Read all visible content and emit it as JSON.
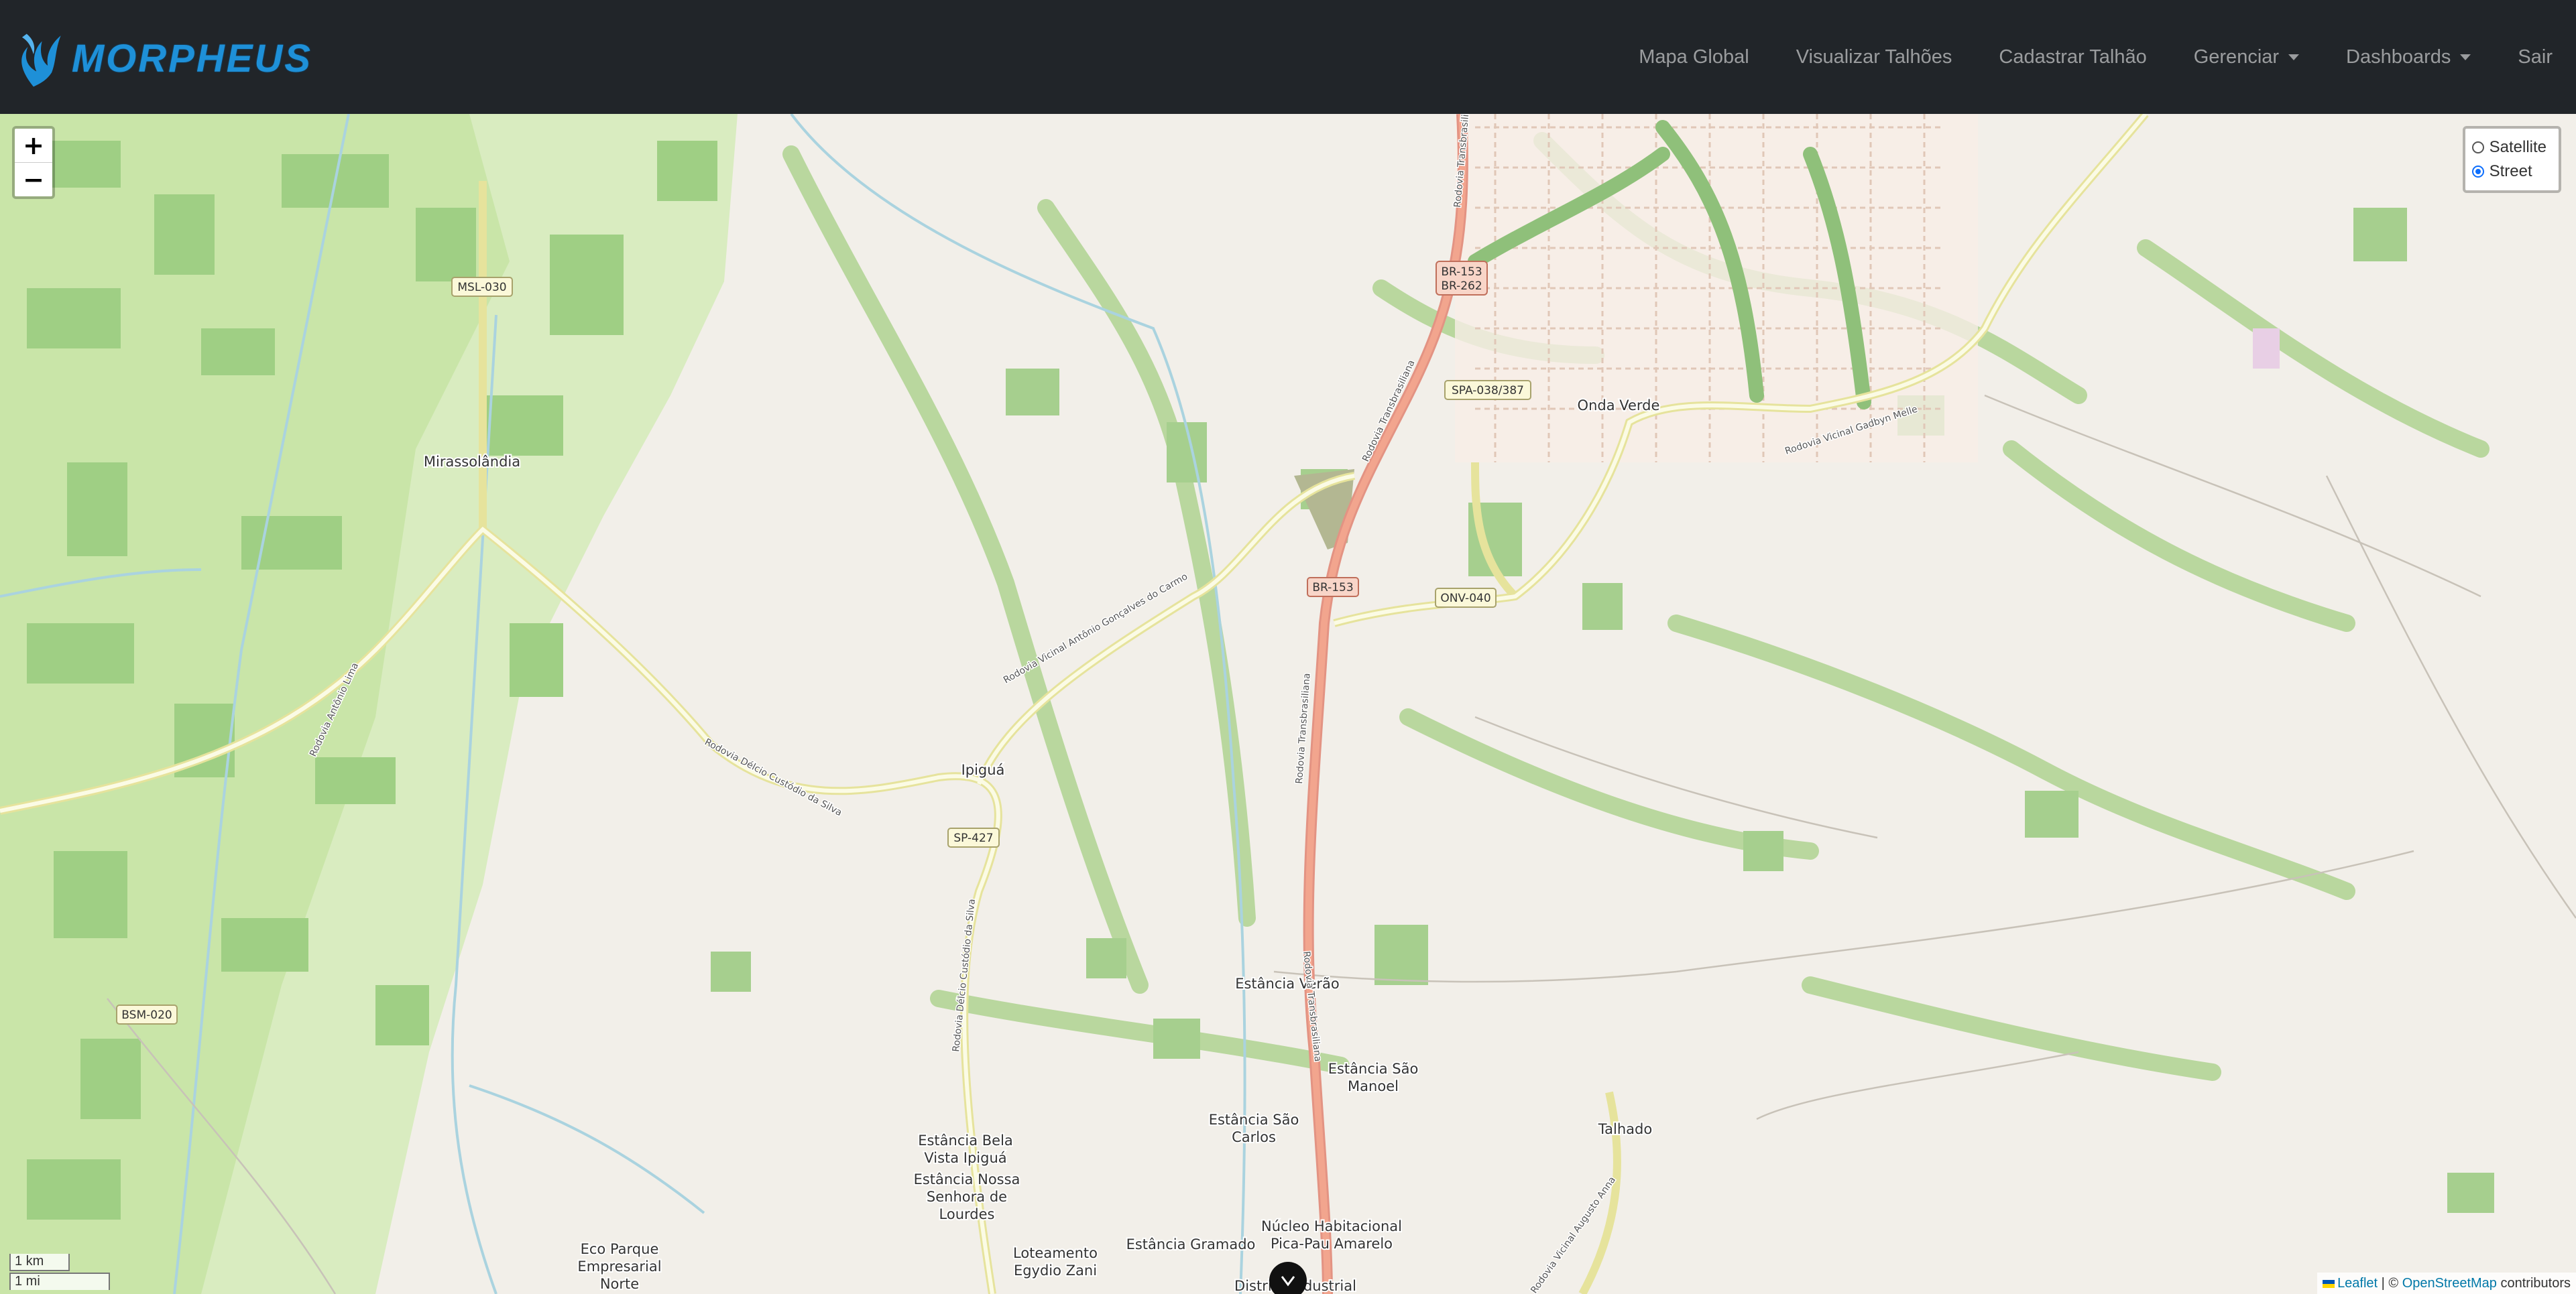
{
  "navbar": {
    "brand": "MORPHEUS",
    "links": [
      {
        "label": "Mapa Global"
      },
      {
        "label": "Visualizar Talhões"
      },
      {
        "label": "Cadastrar Talhão"
      },
      {
        "label": "Gerenciar",
        "dropdown": true
      },
      {
        "label": "Dashboards",
        "dropdown": true
      },
      {
        "label": "Sair"
      }
    ]
  },
  "map": {
    "zoom_in": "+",
    "zoom_out": "−",
    "layers": {
      "options": [
        "Satellite",
        "Street"
      ],
      "selected": "Street"
    },
    "scale": {
      "metric": "1 km",
      "imperial": "1 mi"
    },
    "attribution": {
      "leaflet": "Leaflet",
      "separator": " | © ",
      "osm": "OpenStreetMap",
      "suffix": " contributors"
    },
    "places": {
      "mirassolandia": "Mirassolândia",
      "onda_verde": "Onda Verde",
      "ipigua": "Ipiguá",
      "estancia_verao": "Estância Verão",
      "estancia_sao_manoel_1": "Estância São",
      "estancia_sao_manoel_2": "Manoel",
      "estancia_sao_carlos_1": "Estância São",
      "estancia_sao_carlos_2": "Carlos",
      "talhado": "Talhado",
      "bela_vista_1": "Estância Bela",
      "bela_vista_2": "Vista Ipiguá",
      "nossa_senhora_1": "Estância Nossa",
      "nossa_senhora_2": "Senhora de",
      "nossa_senhora_3": "Lourdes",
      "eco_parque_1": "Eco Parque",
      "eco_parque_2": "Empresarial",
      "eco_parque_3": "Norte",
      "loteamento_1": "Loteamento",
      "loteamento_2": "Egydio Zani",
      "gramado": "Estância Gramado",
      "nucleo_1": "Núcleo Habitacional",
      "nucleo_2": "Pica-Pau Amarelo",
      "distrito": "Distrito Industrial"
    },
    "road_shields": {
      "br153_top": "BR-153",
      "br262": "BR-262",
      "br153_mid": "BR-153",
      "spa038": "SPA-038/387",
      "onv040": "ONV-040",
      "msl030": "MSL-030",
      "sp427": "SP-427",
      "bsm020": "BSM-020"
    },
    "road_names": {
      "transbrasiliana_1": "Rodovia Transbrasiliana",
      "transbrasiliana_2": "Rodovia Transbrasiliana",
      "transbrasiliana_3": "Rodovia Transbrasiliana",
      "gadbyn": "Rodovia Vicinal Gadbyn Melle",
      "antonio": "Rodovia Vicinal Antônio Gonçalves do Carmo",
      "delcio_1": "Rodovia Délcio Custódio da Silva",
      "delcio_2": "Rodovia Délcio Custódio da Silva",
      "antonio_lima": "Rodovia Antônio Lima",
      "auxil": "Rodovia Vicinal Augusto Anna"
    },
    "marker_icon": "chevron-down-icon",
    "colors": {
      "navbar": "#212529",
      "brand": "#1e90d8",
      "land": "#f2efe9",
      "farmland": "#c9e5a8",
      "wood": "#add19e",
      "trunk_road": "#f2a58e",
      "secondary_road": "#f7fabf",
      "water": "#aad3df"
    }
  }
}
